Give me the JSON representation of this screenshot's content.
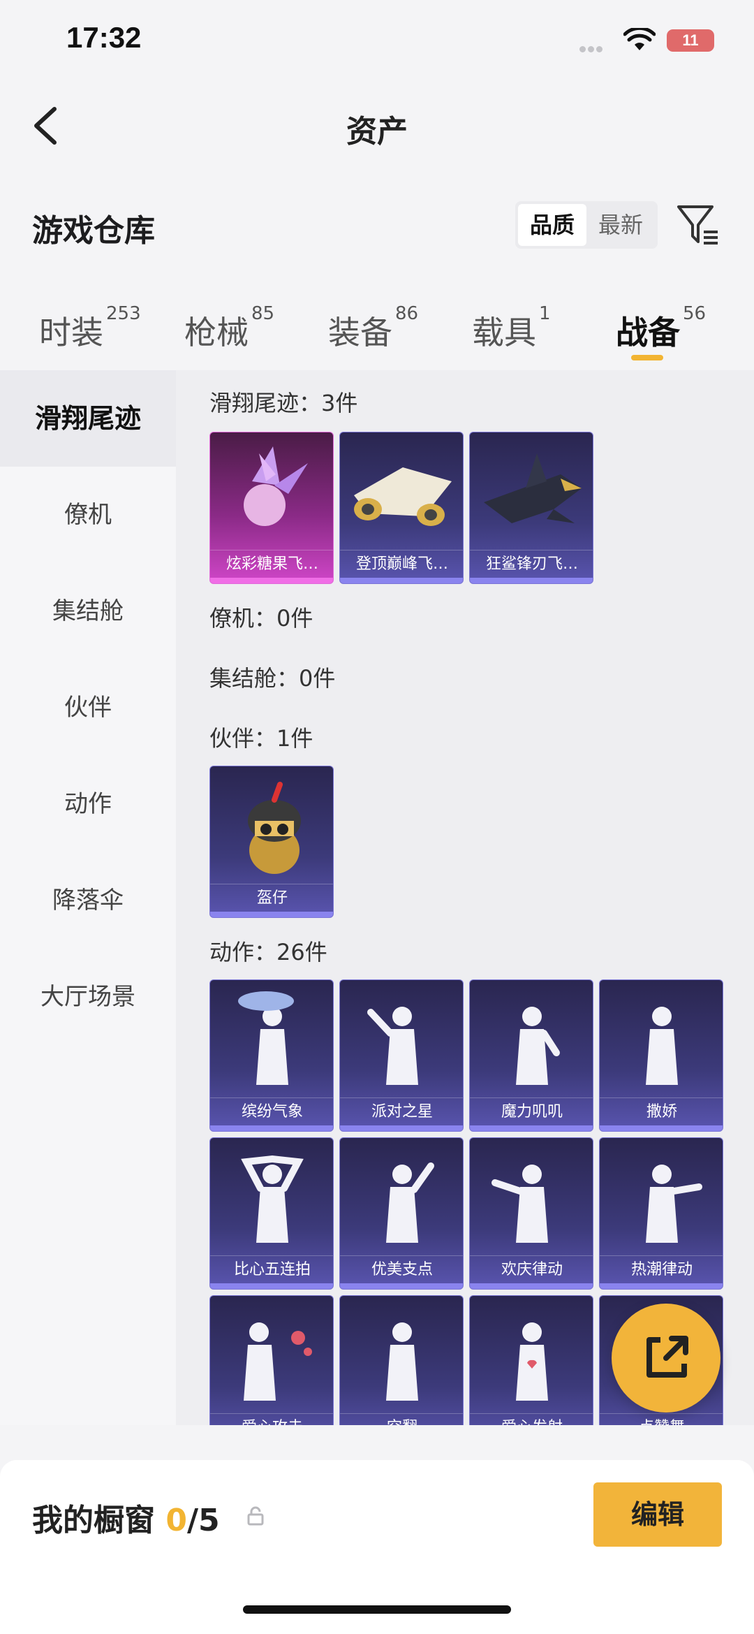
{
  "status": {
    "time": "17:32",
    "battery": "11"
  },
  "header": {
    "title": "资产"
  },
  "section": {
    "title": "游戏仓库",
    "sort_options": [
      "品质",
      "最新"
    ]
  },
  "tabs": [
    {
      "label": "时装",
      "count": "253"
    },
    {
      "label": "枪械",
      "count": "85"
    },
    {
      "label": "装备",
      "count": "86"
    },
    {
      "label": "载具",
      "count": "1"
    },
    {
      "label": "战备",
      "count": "56"
    }
  ],
  "sidenav": [
    "滑翔尾迹",
    "僚机",
    "集结舱",
    "伙伴",
    "动作",
    "降落伞",
    "大厅场景"
  ],
  "groups": {
    "trail": {
      "title": "滑翔尾迹：3件",
      "items": [
        "炫彩糖果飞…",
        "登顶巅峰飞…",
        "狂鲨锋刃飞…"
      ]
    },
    "wingman": {
      "title": "僚机：0件"
    },
    "capsule": {
      "title": "集结舱：0件"
    },
    "partner": {
      "title": "伙伴：1件",
      "items": [
        "盔仔"
      ]
    },
    "emote": {
      "title": "动作：26件",
      "items": [
        "缤纷气象",
        "派对之星",
        "魔力叽叽",
        "撒娇",
        "比心五连拍",
        "优美支点",
        "欢庆律动",
        "热潮律动",
        "爱心攻击",
        "空翻",
        "爱心发射",
        "点赞舞"
      ]
    }
  },
  "bottom": {
    "label": "我的橱窗",
    "current": "0",
    "total": "/5",
    "edit": "编辑"
  },
  "colors": {
    "accent": "#f2b432",
    "card_purple": "#3c3a7a",
    "card_pink": "#8a2a86"
  }
}
